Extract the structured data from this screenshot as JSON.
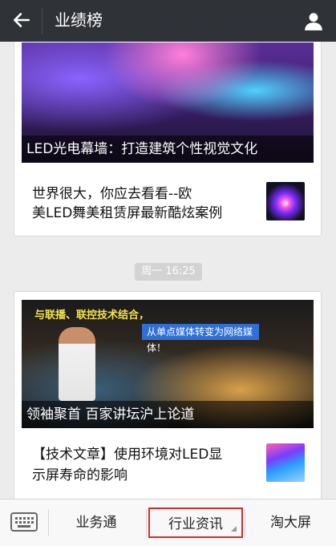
{
  "header": {
    "title": "业绩榜"
  },
  "articles": [
    {
      "caption": "LED光电幕墙：打造建筑个性视觉文化",
      "text_line1": "世界很大，你应去看看--欧",
      "text_line2": "美LED舞美租赁屏最新酷炫案例"
    },
    {
      "slide_line1": "与联播、联控技术结合，",
      "slide_banner": "从单点媒体转变为网络媒体！",
      "caption": "领袖聚首  百家讲坛沪上论道",
      "text_line1": "【技术文章】使用环境对LED显",
      "text_line2": "示屏寿命的影响"
    }
  ],
  "timestamp": "周一 16:25",
  "bottom_menu": {
    "tab1": "业务通",
    "tab2": "行业资讯",
    "tab3": "淘大屏"
  },
  "colors": {
    "topbar": "#2f3236",
    "highlight_border": "#d62b2b"
  }
}
